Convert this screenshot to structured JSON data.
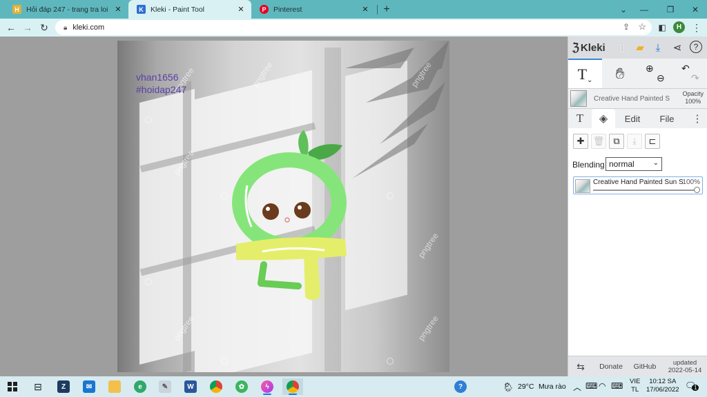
{
  "browser": {
    "tabs": [
      {
        "title": "Hỏi đáp 247 - trang tra loi",
        "icon": "hoidap-favicon",
        "active": false
      },
      {
        "title": "Kleki - Paint Tool",
        "icon": "kleki-favicon",
        "active": true
      },
      {
        "title": "Pinterest",
        "icon": "pinterest-favicon",
        "active": false
      }
    ],
    "new_tab": "+",
    "url": "kleki.com",
    "profile_initial": "H",
    "colors": {
      "tabstrip": "#5fb7be",
      "toolbar": "#d9f1f2"
    }
  },
  "canvas": {
    "text_line1": "vhan1656",
    "text_line2": "#hoidap247",
    "watermark": "pngtree",
    "text_color": "#5b3fa8"
  },
  "kleki": {
    "brand": "Kleki",
    "brush_name": "Creative Hand Painted Sun",
    "opacity_label": "Opacity",
    "opacity_value": "100%",
    "tabs": {
      "text": "T",
      "edit": "Edit",
      "file": "File"
    },
    "blending_label": "Blending",
    "blending_value": "normal",
    "layer": {
      "name": "Creative Hand Painted Sun S",
      "opacity": "100%"
    },
    "footer": {
      "donate": "Donate",
      "github": "GitHub",
      "updated_label": "updated",
      "updated_date": "2022-05-14"
    },
    "colors": {
      "accent": "#3d86d6"
    }
  },
  "taskbar": {
    "weather": "29°C",
    "weather_desc": "Mưa rào",
    "lang_top": "VIE",
    "lang_bottom": "TL",
    "time": "10:12 SA",
    "date": "17/06/2022",
    "notification_count": "1"
  }
}
